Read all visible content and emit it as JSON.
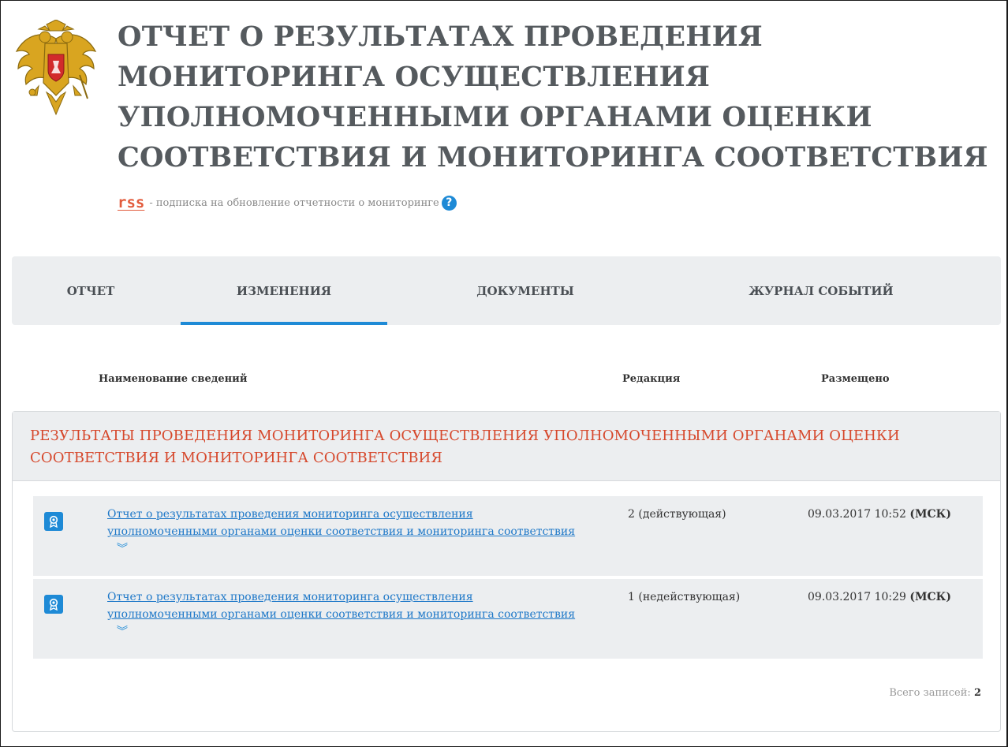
{
  "header": {
    "title": "ОТЧЕТ О РЕЗУЛЬТАТАХ ПРОВЕДЕНИЯ МОНИТОРИНГА ОСУЩЕСТВЛЕНИЯ УПОЛНОМОЧЕННЫМИ ОРГАНАМИ ОЦЕНКИ СООТВЕТСТВИЯ И МОНИТОРИНГА СООТВЕТСТВИЯ",
    "rss_label": "rss",
    "rss_text": "- подписка на обновление отчетности о мониторинге",
    "help_symbol": "?"
  },
  "tabs": [
    {
      "label": "ОТЧЕТ",
      "active": false
    },
    {
      "label": "ИЗМЕНЕНИЯ",
      "active": true
    },
    {
      "label": "ДОКУМЕНТЫ",
      "active": false
    },
    {
      "label": "ЖУРНАЛ СОБЫТИЙ",
      "active": false
    }
  ],
  "columns": {
    "name": "Наименование сведений",
    "revision": "Редакция",
    "posted": "Размещено"
  },
  "section": {
    "title": "РЕЗУЛЬТАТЫ ПРОВЕДЕНИЯ МОНИТОРИНГА ОСУЩЕСТВЛЕНИЯ УПОЛНОМОЧЕННЫМИ ОРГАНАМИ ОЦЕНКИ СООТВЕТСТВИЯ И МОНИТОРИНГА СООТВЕТСТВИЯ"
  },
  "rows": [
    {
      "name": "Отчет о результатах проведения мониторинга осуществления уполномоченными органами оценки соответствия и мониторинга соответствия",
      "revision": "2 (действующая)",
      "date": "09.03.2017 10:52",
      "tz": "(МСК)"
    },
    {
      "name": "Отчет о результатах проведения мониторинга осуществления уполномоченными органами оценки соответствия и мониторинга соответствия",
      "revision": "1 (недействующая)",
      "date": "09.03.2017 10:29",
      "tz": "(МСК)"
    }
  ],
  "footer": {
    "total_label": "Всего записей:",
    "total_value": "2"
  },
  "icons": {
    "emblem": "russian-coat-of-arms",
    "row_icon": "certificate-badge-icon",
    "expand": "double-chevron-down-icon"
  },
  "colors": {
    "accent_blue": "#1e8ad6",
    "section_title": "#d6482c",
    "rss": "#e25b3c",
    "panel_gray": "#eceef0"
  }
}
